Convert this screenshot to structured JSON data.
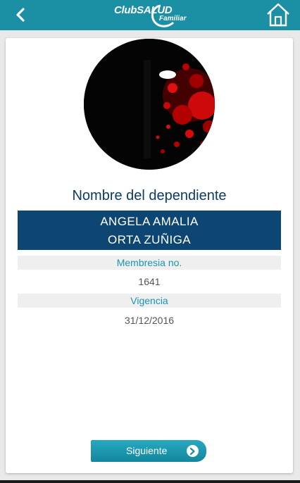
{
  "header": {
    "logo_text": "ClubSALUD",
    "logo_sub": "Familiar",
    "icons": {
      "back": "chevron-left-icon",
      "home": "home-icon"
    },
    "color": "#1b8fa3"
  },
  "profile": {
    "title": "Nombre del dependiente",
    "name_line1": "ANGELA AMALIA",
    "name_line2": "ORTA ZUÑIGA",
    "membership_label": "Membresia no.",
    "membership_value": "1641",
    "validity_label": "Vigencia",
    "validity_value": "31/12/2016"
  },
  "actions": {
    "next_label": "Siguiente"
  },
  "colors": {
    "name_bg": "#0e4673",
    "label_text": "#1a95b0",
    "title_text": "#0c3b68"
  }
}
